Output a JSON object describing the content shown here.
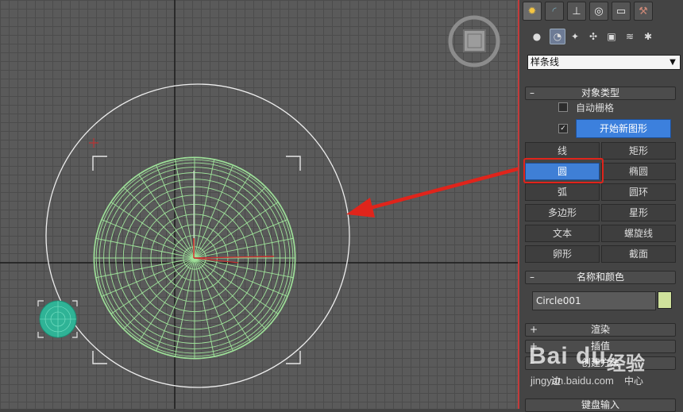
{
  "colors": {
    "accent": "#3f7fd6",
    "highlight": "#e0241b",
    "mesh": "#9fe39a",
    "swatch": "#cfe19b"
  },
  "panel": {
    "tabs": [
      "create-icon",
      "modify-icon",
      "hierarchy-icon",
      "motion-icon",
      "display-icon",
      "utilities-icon"
    ],
    "categories": [
      "geometry-icon",
      "shapes-icon",
      "lights-icon",
      "cameras-icon",
      "helpers-icon",
      "spacewarps-icon",
      "systems-icon"
    ],
    "dropdown": "样条线",
    "object_type": {
      "header": "对象类型",
      "collapse_sign": "–",
      "auto_grid": "自动栅格",
      "start_new_shape": "开始新图形",
      "buttons": [
        "线",
        "矩形",
        "圆",
        "椭圆",
        "弧",
        "圆环",
        "多边形",
        "星形",
        "文本",
        "螺旋线",
        "卵形",
        "截面"
      ],
      "selected": "圆"
    },
    "name_color": {
      "header": "名称和颜色",
      "collapse_sign": "–",
      "name_value": "Circle001"
    },
    "rollouts": [
      {
        "sign": "+",
        "label": "渲染"
      },
      {
        "sign": "+",
        "label": "插值"
      },
      {
        "sign": "–",
        "label": "创建方法"
      }
    ],
    "creation_options": [
      "边",
      "中心"
    ],
    "bottom_rollout": "键盘输入"
  },
  "watermark": {
    "logo": "Bai du",
    "text": "经验",
    "url": "jingyan.baidu.com"
  }
}
